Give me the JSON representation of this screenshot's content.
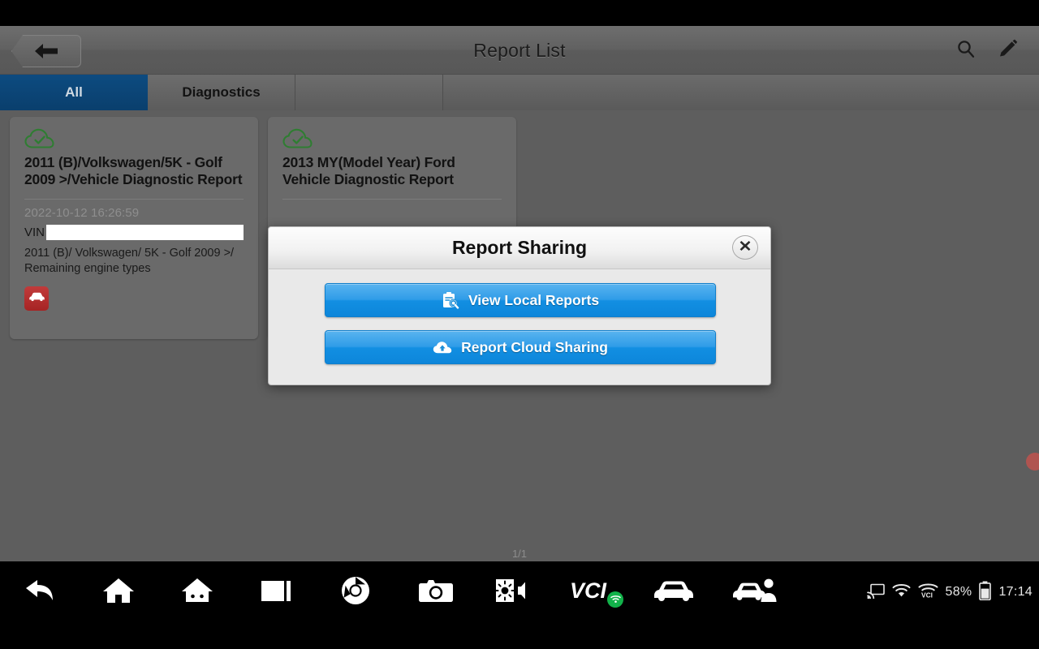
{
  "header": {
    "title": "Report List",
    "back_icon": "back-arrow-icon",
    "search_icon": "search-icon",
    "edit_icon": "edit-pencil-icon"
  },
  "tabs": [
    {
      "label": "All",
      "active": true
    },
    {
      "label": "Diagnostics",
      "active": false
    },
    {
      "label": "",
      "active": false
    }
  ],
  "cards": [
    {
      "cloud_icon": "cloud-check-icon",
      "title": "2011 (B)/Volkswagen/5K - Golf  2009 >/Vehicle Diagnostic Report",
      "date": "2022-10-12 16:26:59",
      "vin_label": "VIN",
      "vin_value": "",
      "subtitle": "2011 (B)/ Volkswagen/ 5K - Golf 2009 >/ Remaining engine types",
      "badge_icon": "car-icon"
    },
    {
      "cloud_icon": "cloud-check-icon",
      "title": "2013 MY(Model Year) Ford Vehicle Diagnostic Report",
      "date": "",
      "vin_label": "",
      "vin_value": "",
      "subtitle": "",
      "badge_icon": ""
    }
  ],
  "page_indicator": "1/1",
  "modal": {
    "title": "Report Sharing",
    "close_icon": "close-x-icon",
    "buttons": [
      {
        "label": "View Local Reports",
        "icon": "report-search-icon"
      },
      {
        "label": "Report Cloud Sharing",
        "icon": "cloud-upload-icon"
      }
    ]
  },
  "navbar": {
    "items": [
      {
        "icon": "back-arrow-icon"
      },
      {
        "icon": "home-icon"
      },
      {
        "icon": "android-home-icon"
      },
      {
        "icon": "recents-icon"
      },
      {
        "icon": "chrome-browser-icon"
      },
      {
        "icon": "camera-icon"
      },
      {
        "icon": "brightness-volume-icon"
      },
      {
        "icon": "vci-icon",
        "label": "VCI"
      },
      {
        "icon": "car-icon"
      },
      {
        "icon": "car-technician-icon"
      }
    ],
    "status": {
      "cast_icon": "cast-icon",
      "wifi_icon": "wifi-icon",
      "vci_wifi_icon": "vci-wifi-icon",
      "battery_percent": "58%",
      "battery_icon": "battery-icon",
      "clock": "17:14"
    }
  },
  "colors": {
    "accent_blue": "#128fe2",
    "tab_active": "#0d4b80",
    "cloud_green": "#2f7d32",
    "badge_red": "#a62424",
    "vci_green": "#12b24a"
  }
}
